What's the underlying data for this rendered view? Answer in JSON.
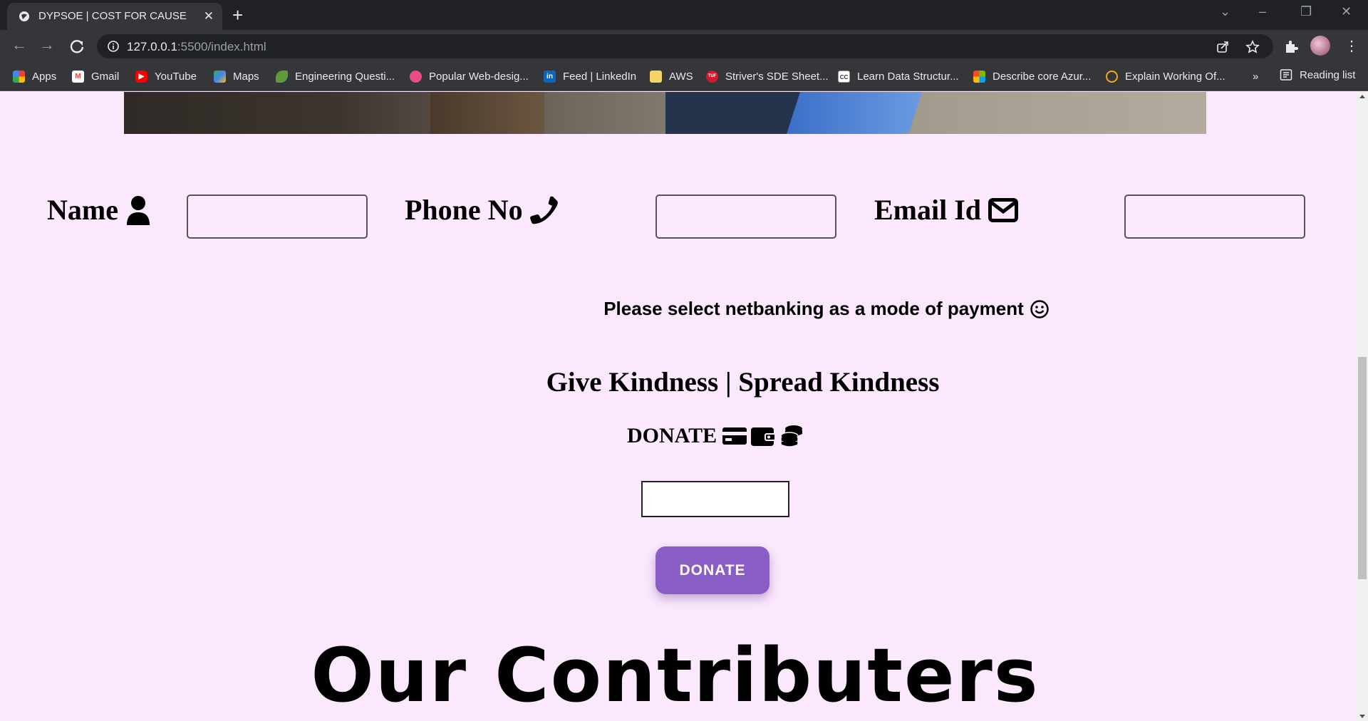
{
  "browser": {
    "tab_title": "DYPSOE | COST FOR CAUSE",
    "url_host": "127.0.0.1",
    "url_rest": ":5500/index.html",
    "bookmarks": [
      {
        "label": "Apps",
        "icon": "apps-grid-icon"
      },
      {
        "label": "Gmail",
        "icon": "gmail-icon"
      },
      {
        "label": "YouTube",
        "icon": "youtube-icon"
      },
      {
        "label": "Maps",
        "icon": "maps-icon"
      },
      {
        "label": "Engineering Questi...",
        "icon": "leaf-icon"
      },
      {
        "label": "Popular Web-desig...",
        "icon": "dribbble-icon"
      },
      {
        "label": "Feed | LinkedIn",
        "icon": "linkedin-icon"
      },
      {
        "label": "AWS",
        "icon": "folder-icon"
      },
      {
        "label": "Striver's SDE Sheet...",
        "icon": "tuf-icon"
      },
      {
        "label": "Learn Data Structur...",
        "icon": "cc-icon"
      },
      {
        "label": "Describe core Azur...",
        "icon": "microsoft-icon"
      },
      {
        "label": "Explain Working Of...",
        "icon": "quora-icon"
      }
    ],
    "overflow_label": "»",
    "reading_list": "Reading list"
  },
  "form": {
    "name_label": "Name",
    "phone_label": "Phone No",
    "email_label": "Email Id"
  },
  "payment_note": "Please select netbanking as a mode of payment",
  "tagline": "Give Kindness | Spread Kindness",
  "donate_heading": "DONATE",
  "donate_button": "DONATE",
  "contributors_heading": "Our Contributers",
  "colors": {
    "page_bg": "#fbe8fd",
    "button_bg": "#8a5cc6",
    "chrome_dark": "#202124",
    "chrome_mid": "#35363a"
  }
}
